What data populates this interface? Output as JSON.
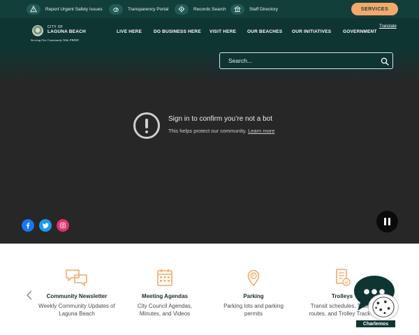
{
  "colors": {
    "utility_bg": "#133f3a",
    "header_bg": "#0f3532",
    "hero_bg": "#272727",
    "accent": "#f4a96a",
    "icon_orange": "#f4a96a"
  },
  "utility": {
    "items": [
      {
        "label": "Report Urgent Safety Issues",
        "icon": "warning-icon"
      },
      {
        "label": "Transparency Portal",
        "icon": "gauge-icon"
      },
      {
        "label": "Records Search",
        "icon": "gear-icon"
      },
      {
        "label": "Staff Directory",
        "icon": "building-icon"
      }
    ],
    "services_label": "SERVICES"
  },
  "header": {
    "logo_city": "CITY OF",
    "logo_name": "LAGUNA BEACH",
    "logo_tagline": "Serving Our Community With PRIDE",
    "nav": [
      "LIVE HERE",
      "DO BUSINESS HERE",
      "VISIT HERE",
      "OUR BEACHES",
      "OUR INITIATIVES",
      "GOVERNMENT"
    ],
    "translate_label": "Translate"
  },
  "search": {
    "placeholder": "Search..."
  },
  "notice": {
    "title": "Sign in to confirm you’re not a bot",
    "subtitle": "This helps protect our community.",
    "link": "Learn more"
  },
  "social": [
    {
      "name": "facebook",
      "color": "#1877f2"
    },
    {
      "name": "twitter",
      "color": "#1d9bf0"
    },
    {
      "name": "instagram",
      "color": "#e1306c"
    }
  ],
  "quick_links": [
    {
      "title": "Community Newsletter",
      "desc": "Weekly Community Updates of Laguna Beach",
      "icon": "chat-bubbles-icon"
    },
    {
      "title": "Meeting Agendas",
      "desc": "City Council Agendas, Minutes, and Videos",
      "icon": "calendar-icon"
    },
    {
      "title": "Parking",
      "desc": "Parking lots and parking permits",
      "icon": "parking-pin-icon"
    },
    {
      "title": "Trolleys",
      "desc": "Transit schedules, Trolley routes, and Trolley Tracker",
      "icon": "document-check-icon"
    }
  ],
  "chat": {
    "label": "Charlemos"
  }
}
